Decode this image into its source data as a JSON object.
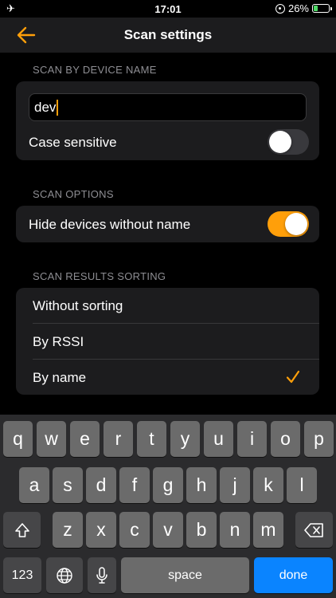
{
  "status_bar": {
    "time": "17:01",
    "battery_percent": "26%",
    "battery_level": 0.26
  },
  "nav": {
    "title": "Scan settings"
  },
  "sections": {
    "by_name": {
      "header": "SCAN BY DEVICE NAME",
      "name_value": "dev",
      "case_sensitive_label": "Case sensitive",
      "case_sensitive_on": false
    },
    "options": {
      "header": "SCAN OPTIONS",
      "hide_label": "Hide devices without name",
      "hide_on": true
    },
    "sorting": {
      "header": "SCAN RESULTS SORTING",
      "items": [
        {
          "label": "Without sorting",
          "selected": false
        },
        {
          "label": "By RSSI",
          "selected": false
        },
        {
          "label": "By name",
          "selected": true
        }
      ]
    }
  },
  "keyboard": {
    "row1": [
      "q",
      "w",
      "e",
      "r",
      "t",
      "y",
      "u",
      "i",
      "o",
      "p"
    ],
    "row2": [
      "a",
      "s",
      "d",
      "f",
      "g",
      "h",
      "j",
      "k",
      "l"
    ],
    "row3": [
      "z",
      "x",
      "c",
      "v",
      "b",
      "n",
      "m"
    ],
    "numbers_label": "123",
    "space_label": "space",
    "done_label": "done"
  },
  "colors": {
    "accent": "#ff9f0a",
    "done_key": "#0a84ff",
    "panel": "#1c1c1e"
  },
  "icons": {
    "airplane": "airplane-icon",
    "orientation_lock": "orientation-lock-icon",
    "battery": "battery-icon",
    "back": "back-arrow-icon",
    "check": "checkmark-icon",
    "shift": "shift-icon",
    "delete": "delete-icon",
    "globe": "globe-icon",
    "mic": "microphone-icon"
  }
}
